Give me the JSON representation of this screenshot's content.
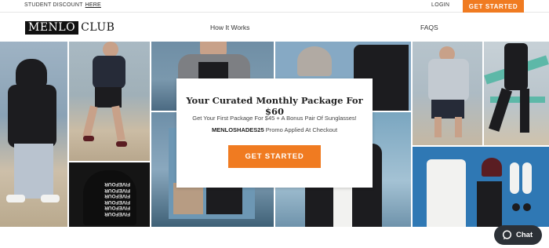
{
  "topbar": {
    "promo_text": "STUDENT DISCOUNT",
    "promo_link": "HERE",
    "login": "LOGIN",
    "cta": "GET STARTED"
  },
  "nav": {
    "logo_boxed": "MENLO",
    "logo_rest": "CLUB",
    "links": [
      "How It Works",
      "FAQS"
    ]
  },
  "hero": {
    "sweatshirt_text": "FIVEFOUR FIVEFOUR FIVEFOUR FIVEFOUR FIVEFOUR FIVEFOUR"
  },
  "promo_card": {
    "title": "Your Curated Monthly Package For $60",
    "subtitle": "Get Your First Package For $45 + A Bonus Pair Of Sunglasses!",
    "code": "MENLOSHADES25",
    "code_suffix": " Promo Applied At Checkout",
    "button": "GET STARTED"
  },
  "chat": {
    "label": "Chat",
    "icon": "chat-bubble-icon"
  },
  "colors": {
    "accent": "#f07b21",
    "chat_bg": "#2c3137"
  }
}
